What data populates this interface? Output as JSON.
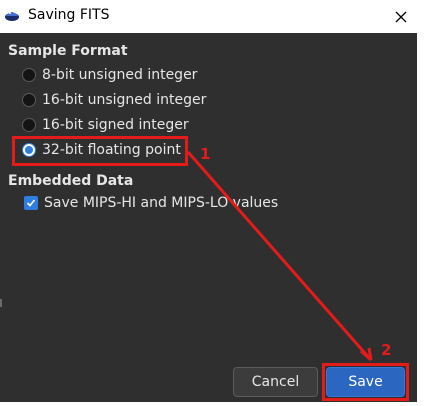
{
  "window": {
    "title": "Saving FITS",
    "close_icon": "close-icon",
    "app_icon": "fits-app-icon"
  },
  "sample_format": {
    "heading": "Sample Format",
    "options": [
      {
        "label": "8-bit unsigned integer",
        "checked": false
      },
      {
        "label": "16-bit unsigned integer",
        "checked": false
      },
      {
        "label": "16-bit signed integer",
        "checked": false
      },
      {
        "label": "32-bit floating point",
        "checked": true
      }
    ]
  },
  "embedded_data": {
    "heading": "Embedded Data",
    "checkbox": {
      "label": "Save MIPS-HI and MIPS-LO values",
      "checked": true
    }
  },
  "buttons": {
    "cancel": "Cancel",
    "save": "Save"
  },
  "annotations": {
    "step1": "1",
    "step2": "2",
    "color": "#e41b1b"
  },
  "colors": {
    "accent": "#2f7de1",
    "save_button": "#2b66c1",
    "background": "#2f2f2f"
  }
}
